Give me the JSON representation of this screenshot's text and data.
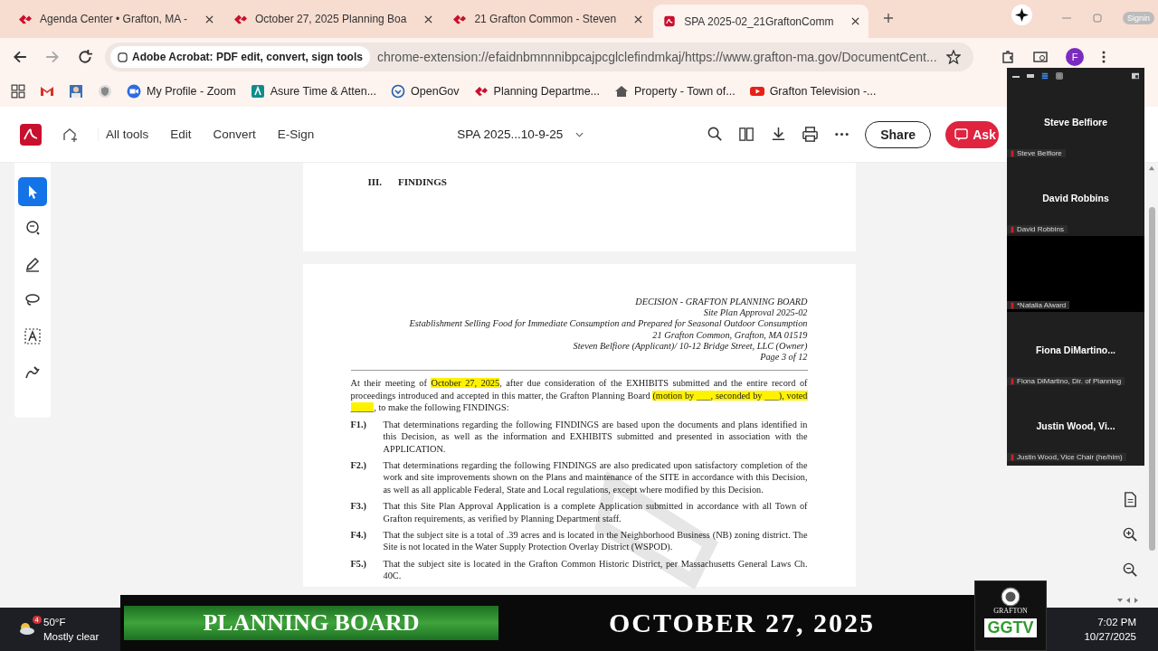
{
  "browser": {
    "tabs": [
      {
        "title": "Agenda Center • Grafton, MA -",
        "kind": "site",
        "selected": false
      },
      {
        "title": "October 27, 2025 Planning Boa",
        "kind": "site",
        "selected": false
      },
      {
        "title": "21 Grafton Common - Steven",
        "kind": "site",
        "selected": false
      },
      {
        "title": "SPA 2025-02_21GraftonComm",
        "kind": "pdf",
        "selected": true
      }
    ],
    "profile_label": "Signin",
    "address": {
      "chip": "Adobe Acrobat: PDF edit, convert, sign tools",
      "url": "chrome-extension://efaidnbmnnnibpcajpcglclefindmkaj/https://www.grafton-ma.gov/DocumentCent..."
    },
    "profile_initial": "F",
    "bookmarks": [
      {
        "kind": "gmail"
      },
      {
        "kind": "photo"
      },
      {
        "kind": "shield"
      },
      {
        "label": "My Profile - Zoom",
        "kind": "zoom"
      },
      {
        "label": "Asure Time & Atten...",
        "kind": "asure"
      },
      {
        "label": "OpenGov",
        "kind": "opengov"
      },
      {
        "label": "Planning Departme...",
        "kind": "site"
      },
      {
        "label": "Property - Town of...",
        "kind": "home"
      },
      {
        "label": "Grafton Television -...",
        "kind": "youtube"
      }
    ]
  },
  "acrobat": {
    "menu": [
      "All tools",
      "Edit",
      "Convert",
      "E-Sign"
    ],
    "doc_title": "SPA 2025...10-9-25",
    "share": "Share",
    "ask": "Ask",
    "tools": [
      {
        "kind": "select",
        "selected": true
      },
      {
        "kind": "comment",
        "selected": false
      },
      {
        "kind": "pen",
        "selected": false
      },
      {
        "kind": "lasso",
        "selected": false
      },
      {
        "kind": "text",
        "selected": false
      },
      {
        "kind": "sign",
        "selected": false
      }
    ]
  },
  "document": {
    "prev_page": {
      "number": "III.",
      "heading": "FINDINGS"
    },
    "header": [
      "DECISION - GRAFTON PLANNING BOARD",
      "Site Plan Approval 2025-02",
      "Establishment Selling Food for Immediate Consumption and Prepared for Seasonal Outdoor Consumption",
      "21 Grafton Common, Grafton, MA 01519",
      "Steven Belfiore (Applicant)/ 10-12 Bridge Street, LLC (Owner)",
      "Page 3 of 12"
    ],
    "intro": [
      {
        "text": "At their meeting of ",
        "highlighted": false
      },
      {
        "text": "October 27, 2025",
        "highlighted": true
      },
      {
        "text": ", after due consideration of the EXHIBITS submitted and the entire record of proceedings introduced and accepted in this matter, the Grafton Planning Board ",
        "highlighted": false
      },
      {
        "text": "(motion by ___, seconded by ___), voted _____",
        "highlighted": true
      },
      {
        "text": ", to make the following FINDINGS:",
        "highlighted": false
      }
    ],
    "findings": [
      {
        "label": "F1.)",
        "text": "That determinations regarding the following FINDINGS are based upon the documents and plans identified in this Decision, as well as the information and EXHIBITS submitted and presented in association with the APPLICATION."
      },
      {
        "label": "F2.)",
        "text": "That determinations regarding the following FINDINGS are also predicated upon satisfactory completion of the work and site improvements shown on the Plans and maintenance of the SITE in accordance with this Decision, as well as all applicable Federal, State and Local regulations, except where modified by this Decision."
      },
      {
        "label": "F3.)",
        "text": "That this Site Plan Approval Application is a complete Application submitted in accordance with all Town of Grafton requirements, as verified by Planning Department staff."
      },
      {
        "label": "F4.)",
        "text": "That the subject site is a total of .39 acres and is located in the Neighborhood Business (NB) zoning district. The Site is not located in the Water Supply Protection Overlay District (WSPOD)."
      },
      {
        "label": "F5.)",
        "text": "That the subject site is located in the Grafton Common Historic District, per Massachusetts General Laws Ch. 40C."
      }
    ]
  },
  "zoom_panel": {
    "participants": [
      {
        "kind": "name",
        "display": "Steve Belfiore",
        "label": "Steve Belfiore"
      },
      {
        "kind": "name",
        "display": "David Robbins",
        "label": "David Robbins"
      },
      {
        "kind": "video",
        "label": "*Natalia Alward"
      },
      {
        "kind": "name",
        "display": "Fiona  DiMartino...",
        "label": "Fiona DiMartino, Dir. of Planning"
      },
      {
        "kind": "name",
        "display": "Justin Wood, Vi...",
        "label": "Justin Wood, Vice Chair (he/him)"
      }
    ]
  },
  "banner": {
    "title": "PLANNING BOARD",
    "date": "OCTOBER 27, 2025",
    "logo_caption": "GRAFTON",
    "logo": "GGTV"
  },
  "taskbar": {
    "weather_badge": "4",
    "temperature": "50°F",
    "condition": "Mostly clear",
    "time": "7:02 PM",
    "date": "10/27/2025"
  }
}
